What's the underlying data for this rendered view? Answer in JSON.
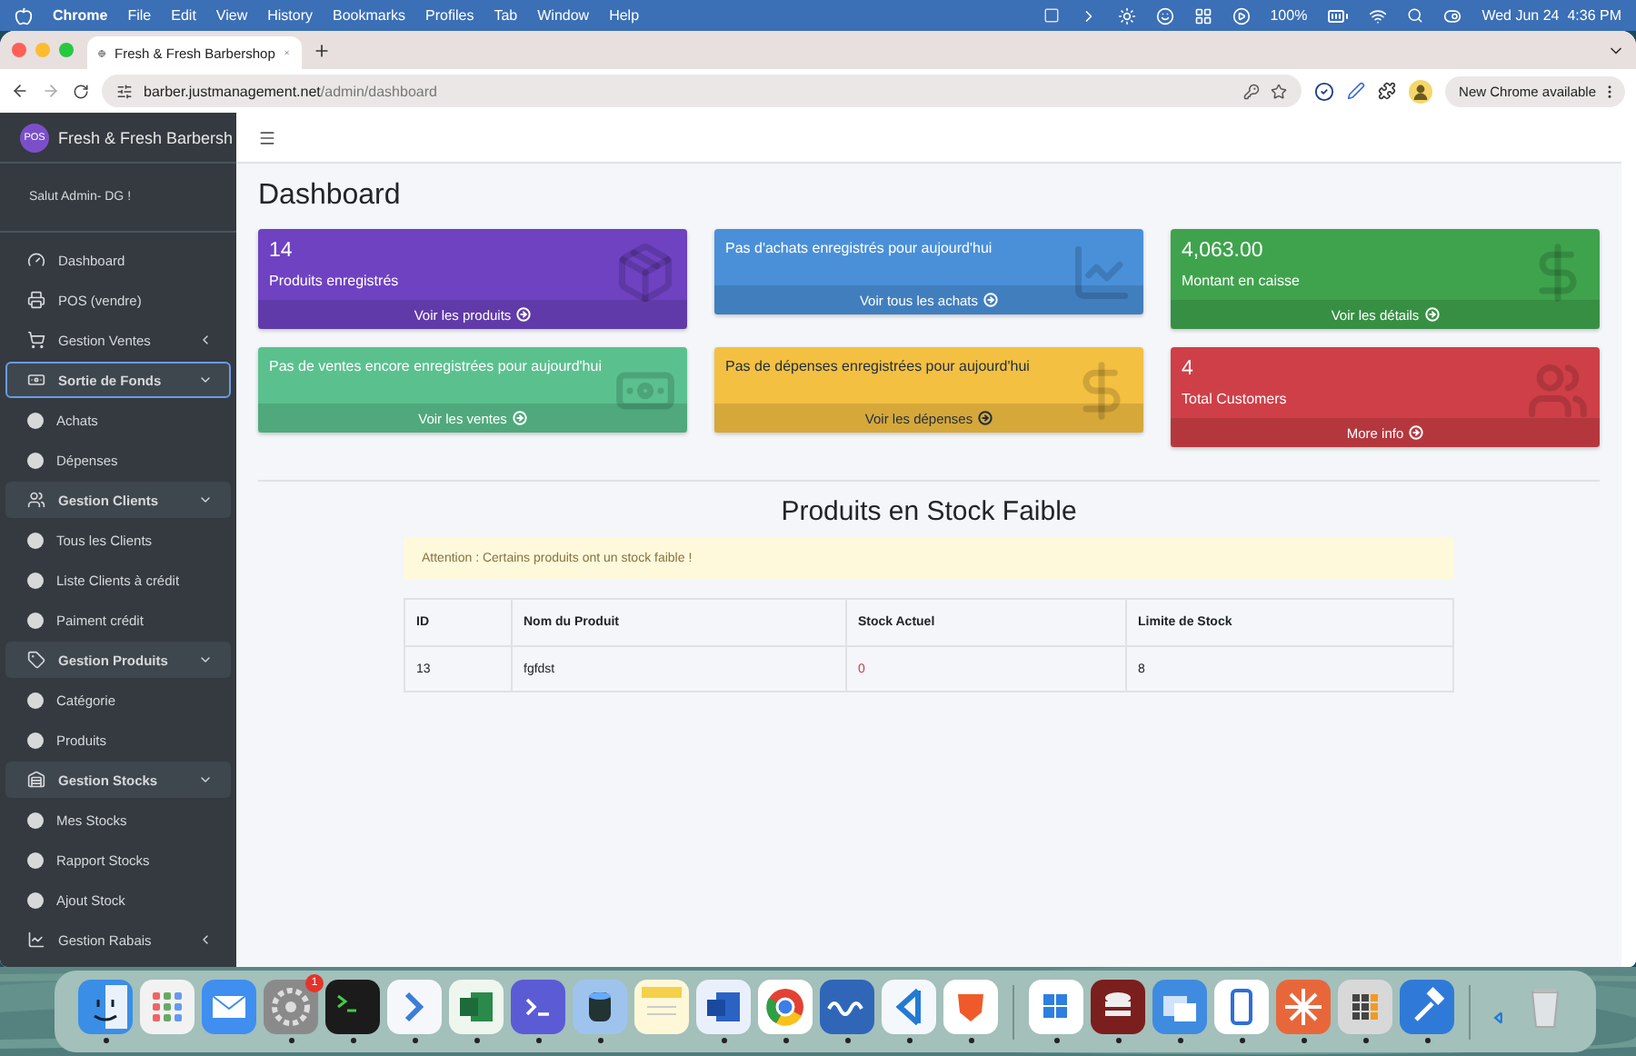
{
  "menubar": {
    "app": "Chrome",
    "menus": [
      "File",
      "Edit",
      "View",
      "History",
      "Bookmarks",
      "Profiles",
      "Tab",
      "Window",
      "Help"
    ],
    "battery": "100%",
    "clock": "Wed Jun 24  4:36 PM"
  },
  "browser": {
    "tab": {
      "title": "Fresh & Fresh Barbershop",
      "selected": true
    },
    "url_host": "barber.justmanagement.net",
    "url_path": "/admin/dashboard",
    "update_button": "New Chrome available"
  },
  "sidebar": {
    "logo": "POS",
    "brand": "Fresh & Fresh Barbersh",
    "greeting": "Salut Admin- DG !",
    "items": [
      {
        "label": "Dashboard",
        "kind": "link",
        "selected": false
      },
      {
        "label": "POS (vendre)",
        "kind": "link",
        "selected": false
      },
      {
        "label": "Gestion Ventes",
        "kind": "group",
        "expanded": false,
        "selected": false
      },
      {
        "label": "Sortie de Fonds",
        "kind": "group",
        "expanded": true,
        "selected": true,
        "children": [
          {
            "label": "Achats",
            "selected": false
          },
          {
            "label": "Dépenses",
            "selected": false
          }
        ]
      },
      {
        "label": "Gestion Clients",
        "kind": "group",
        "expanded": true,
        "selected": false,
        "children": [
          {
            "label": "Tous les Clients",
            "selected": false
          },
          {
            "label": "Liste Clients à crédit",
            "selected": false
          },
          {
            "label": "Paiment crédit",
            "selected": false
          }
        ]
      },
      {
        "label": "Gestion Produits",
        "kind": "group",
        "expanded": true,
        "selected": false,
        "children": [
          {
            "label": "Catégorie",
            "selected": false
          },
          {
            "label": "Produits",
            "selected": false
          }
        ]
      },
      {
        "label": "Gestion Stocks",
        "kind": "group",
        "expanded": true,
        "selected": false,
        "children": [
          {
            "label": "Mes Stocks",
            "selected": false
          },
          {
            "label": "Rapport Stocks",
            "selected": false
          },
          {
            "label": "Ajout Stock",
            "selected": false
          }
        ]
      },
      {
        "label": "Gestion Rabais",
        "kind": "group",
        "expanded": false,
        "selected": false
      }
    ]
  },
  "page": {
    "title": "Dashboard",
    "cards": [
      {
        "value": "14",
        "label": "Produits enregistrés",
        "link": "Voir les produits",
        "color": "#6f42c1"
      },
      {
        "label": "Pas d'achats enregistrés pour aujourd'hui",
        "link": "Voir tous les achats",
        "color": "#4a90d9"
      },
      {
        "value": "4,063.00",
        "label": "Montant en caisse",
        "link": "Voir les détails",
        "color": "#3fa34d"
      },
      {
        "label": "Pas de ventes encore enregistrées pour aujourd'hui",
        "link": "Voir les ventes",
        "color": "#5ac18e"
      },
      {
        "label": "Pas de dépenses enregistrées pour aujourd'hui",
        "link": "Voir les dépenses",
        "color": "#f4c042"
      },
      {
        "value": "4",
        "label": "Total Customers",
        "link": "More info",
        "color": "#cf3f47"
      }
    ],
    "low_stock": {
      "title": "Produits en Stock Faible",
      "alert": "Attention : Certains produits ont un stock faible !",
      "columns": [
        "ID",
        "Nom du Produit",
        "Stock Actuel",
        "Limite de Stock"
      ],
      "rows": [
        {
          "id": "13",
          "name": "fgfdst",
          "stock": "0",
          "stock_low": true,
          "limit": "8"
        }
      ]
    }
  },
  "dock": {
    "sections": [
      {
        "items": [
          {
            "kind": "finder",
            "running": true
          },
          {
            "kind": "launchpad",
            "running": false
          },
          {
            "kind": "mail",
            "running": false
          },
          {
            "kind": "settings",
            "running": true,
            "badge": "1"
          },
          {
            "kind": "terminal",
            "running": true
          },
          {
            "kind": "arrow",
            "running": true
          },
          {
            "kind": "spreadsheet",
            "running": true
          },
          {
            "kind": "prompt",
            "running": true
          },
          {
            "kind": "cylinder",
            "running": true
          },
          {
            "kind": "notes",
            "running": false
          },
          {
            "kind": "document",
            "running": true
          },
          {
            "kind": "browser",
            "running": true
          },
          {
            "kind": "wave",
            "running": true
          },
          {
            "kind": "code",
            "running": true
          },
          {
            "kind": "lion",
            "running": true
          }
        ]
      },
      {
        "items": [
          {
            "kind": "tiles",
            "running": true
          },
          {
            "kind": "database",
            "running": true
          },
          {
            "kind": "windows",
            "running": true
          },
          {
            "kind": "phone",
            "running": true
          },
          {
            "kind": "starburst",
            "running": true
          },
          {
            "kind": "calculator",
            "running": true
          },
          {
            "kind": "hammer",
            "running": true
          }
        ]
      },
      {
        "items": [
          {
            "kind": "mini-code",
            "running": false
          },
          {
            "kind": "trash",
            "running": false
          }
        ]
      }
    ]
  }
}
